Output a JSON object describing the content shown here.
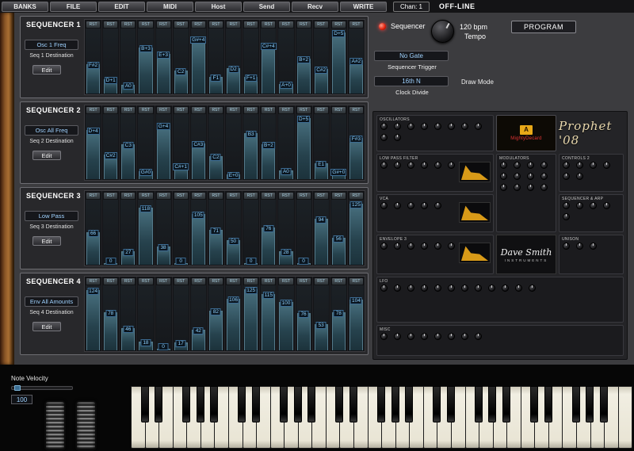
{
  "menu": {
    "buttons": [
      "BANKS",
      "FILE",
      "EDIT",
      "MIDI",
      "Host",
      "Send",
      "Recv",
      "WRITE"
    ],
    "channel": "Chan: 1",
    "status": "OFF-LINE"
  },
  "transport": {
    "sequencer_label": "Sequencer",
    "tempo_value": "120 bpm",
    "tempo_label": "Tempo",
    "gate_value": "No Gate",
    "trigger_label": "Sequencer Trigger",
    "clock_value": "16th N",
    "clock_label": "Clock Divide",
    "draw_mode_label": "Draw Mode",
    "program_button": "PROGRAM"
  },
  "sequencers": [
    {
      "title": "SEQUENCER 1",
      "destination": "Osc 1 Freq",
      "destination_label": "Seq 1 Destination",
      "edit_button": "Edit",
      "step_button": "RST",
      "steps": [
        {
          "label": "F#2",
          "value": 60
        },
        {
          "label": "D+1",
          "value": 29
        },
        {
          "label": "A0",
          "value": 18
        },
        {
          "label": "B+3",
          "value": 95
        },
        {
          "label": "E+3",
          "value": 81
        },
        {
          "label": "C2",
          "value": 48
        },
        {
          "label": "G#+4",
          "value": 113
        },
        {
          "label": "F1",
          "value": 34
        },
        {
          "label": "D2",
          "value": 52
        },
        {
          "label": "F+1",
          "value": 35
        },
        {
          "label": "C#+4",
          "value": 99
        },
        {
          "label": "A+0",
          "value": 19
        },
        {
          "label": "B+2",
          "value": 71
        },
        {
          "label": "C#2",
          "value": 50
        },
        {
          "label": "D+5",
          "value": 125
        },
        {
          "label": "A#2",
          "value": 68
        }
      ]
    },
    {
      "title": "SEQUENCER 2",
      "destination": "Osc All Freq",
      "destination_label": "Seq 2 Destination",
      "edit_button": "Edit",
      "step_button": "RST",
      "steps": [
        {
          "label": "D+4",
          "value": 101
        },
        {
          "label": "C#2",
          "value": 50
        },
        {
          "label": "C3",
          "value": 72
        },
        {
          "label": "G#0",
          "value": 16
        },
        {
          "label": "G+4",
          "value": 111
        },
        {
          "label": "C#+1",
          "value": 27
        },
        {
          "label": "C#3",
          "value": 74
        },
        {
          "label": "C2",
          "value": 48
        },
        {
          "label": "E+0",
          "value": 9
        },
        {
          "label": "B3",
          "value": 94
        },
        {
          "label": "B+2",
          "value": 71
        },
        {
          "label": "A0",
          "value": 18
        },
        {
          "label": "D+5",
          "value": 125
        },
        {
          "label": "E1",
          "value": 32
        },
        {
          "label": "G#+0",
          "value": 17
        },
        {
          "label": "F#3",
          "value": 84
        }
      ]
    },
    {
      "title": "SEQUENCER 3",
      "destination": "Low Pass",
      "destination_label": "Seq 3 Destination",
      "edit_button": "Edit",
      "step_button": "RST",
      "steps": [
        {
          "label": "66",
          "value": 66
        },
        {
          "label": "0",
          "value": 0
        },
        {
          "label": "27",
          "value": 27
        },
        {
          "label": "118",
          "value": 118
        },
        {
          "label": "38",
          "value": 38
        },
        {
          "label": "0",
          "value": 0
        },
        {
          "label": "105",
          "value": 105
        },
        {
          "label": "71",
          "value": 71
        },
        {
          "label": "50",
          "value": 50
        },
        {
          "label": "0",
          "value": 0
        },
        {
          "label": "76",
          "value": 76
        },
        {
          "label": "28",
          "value": 28
        },
        {
          "label": "0",
          "value": 0
        },
        {
          "label": "94",
          "value": 94
        },
        {
          "label": "56",
          "value": 56
        },
        {
          "label": "125",
          "value": 125
        }
      ]
    },
    {
      "title": "SEQUENCER 4",
      "destination": "Env All Amounts",
      "destination_label": "Seq 4 Destination",
      "edit_button": "Edit",
      "step_button": "RST",
      "steps": [
        {
          "label": "124",
          "value": 124
        },
        {
          "label": "78",
          "value": 78
        },
        {
          "label": "46",
          "value": 46
        },
        {
          "label": "18",
          "value": 18
        },
        {
          "label": "0",
          "value": 0
        },
        {
          "label": "17",
          "value": 17
        },
        {
          "label": "42",
          "value": 42
        },
        {
          "label": "82",
          "value": 82
        },
        {
          "label": "106",
          "value": 106
        },
        {
          "label": "125",
          "value": 125
        },
        {
          "label": "115",
          "value": 115
        },
        {
          "label": "100",
          "value": 100
        },
        {
          "label": "76",
          "value": 76
        },
        {
          "label": "53",
          "value": 53
        },
        {
          "label": "78",
          "value": 78
        },
        {
          "label": "104",
          "value": 104
        }
      ]
    }
  ],
  "panel": {
    "logo": "Prophet '08",
    "brand_line1": "Dave Smith",
    "brand_line2": "INSTRUMENTS",
    "display_bank": "A",
    "display_name": "MightyDecard",
    "sections": [
      {
        "area": "osc",
        "title": "OSCILLATORS",
        "knobs": 10,
        "env": false
      },
      {
        "area": "lpf",
        "title": "LOW PASS FILTER",
        "knobs": 6,
        "env": true
      },
      {
        "area": "mod1",
        "title": "MODULATORS",
        "knobs": 12,
        "env": false
      },
      {
        "area": "ctl",
        "title": "CONTROLS 2",
        "knobs": 6,
        "env": false
      },
      {
        "area": "vca",
        "title": "VCA",
        "knobs": 5,
        "env": true
      },
      {
        "area": "seqarp",
        "title": "SEQUENCER & ARP",
        "knobs": 5,
        "env": false
      },
      {
        "area": "env3",
        "title": "ENVELOPE 3",
        "knobs": 6,
        "env": true
      },
      {
        "area": "uni",
        "title": "UNISON",
        "knobs": 3,
        "env": false
      },
      {
        "area": "lfo",
        "title": "LFO",
        "knobs": 12,
        "env": false
      },
      {
        "area": "misc",
        "title": "MISC",
        "knobs": 8,
        "env": false
      }
    ]
  },
  "keyboard": {
    "velocity_label": "Note Velocity",
    "velocity_value": "100"
  }
}
